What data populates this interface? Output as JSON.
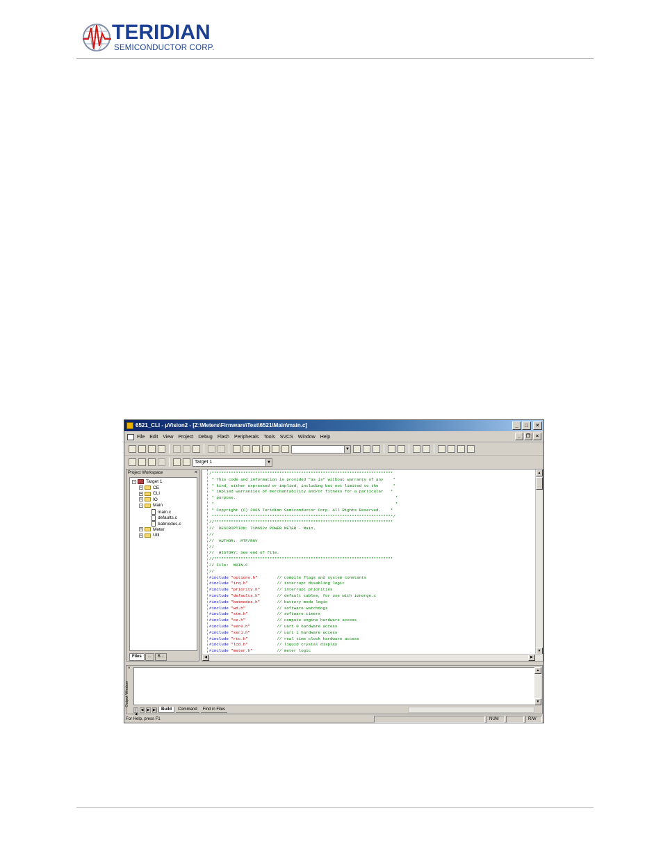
{
  "header": {
    "brand": "TERIDIAN",
    "subtitle": "SEMICONDUCTOR CORP."
  },
  "window": {
    "title": "6521_CLI - µVision2 - [Z:\\Meters\\Firmware\\Test\\6521\\Main\\main.c]",
    "menu": [
      "File",
      "Edit",
      "View",
      "Project",
      "Debug",
      "Flash",
      "Peripherals",
      "Tools",
      "SVCS",
      "Window",
      "Help"
    ],
    "toolbar_combo_value": "",
    "target_combo_value": "Target 1"
  },
  "workspace": {
    "title": "Project Workspace",
    "close_glyph": "×",
    "tree": [
      {
        "label": "Target 1",
        "kind": "target",
        "depth": 0,
        "expander": "-"
      },
      {
        "label": "CE",
        "kind": "folder",
        "depth": 1,
        "expander": "+"
      },
      {
        "label": "CLI",
        "kind": "folder",
        "depth": 1,
        "expander": "+"
      },
      {
        "label": "IO",
        "kind": "folder",
        "depth": 1,
        "expander": "+"
      },
      {
        "label": "Main",
        "kind": "folder",
        "depth": 1,
        "expander": "-"
      },
      {
        "label": "main.c",
        "kind": "file",
        "depth": 2,
        "expander": ""
      },
      {
        "label": "defaults.c",
        "kind": "file",
        "depth": 2,
        "expander": ""
      },
      {
        "label": "batmodes.c",
        "kind": "file",
        "depth": 2,
        "expander": ""
      },
      {
        "label": "Meter",
        "kind": "folder",
        "depth": 1,
        "expander": "+"
      },
      {
        "label": "Util",
        "kind": "folder",
        "depth": 1,
        "expander": "+"
      }
    ],
    "tabs": [
      "Files",
      "...",
      "B..."
    ]
  },
  "editor": {
    "lines": [
      [
        {
          "t": "/***************************************************************************",
          "c": "g"
        }
      ],
      [
        {
          "t": " * This code and information is provided \"as is\" without warranty of any    *",
          "c": "g"
        }
      ],
      [
        {
          "t": " * kind, either expressed or implied, including but not limited to the      *",
          "c": "g"
        }
      ],
      [
        {
          "t": " * implied warranties of merchantability and/or fitness for a particular   *",
          "c": "g"
        }
      ],
      [
        {
          "t": " * purpose.                                                                  *",
          "c": "g"
        }
      ],
      [
        {
          "t": " *                                                                           *",
          "c": "g"
        }
      ],
      [
        {
          "t": " * Copyright (C) 2005 Teridian Semiconductor Corp. All Rights Reserved.    *",
          "c": "g"
        }
      ],
      [
        {
          "t": " ***************************************************************************/",
          "c": "g"
        }
      ],
      [
        {
          "t": "//**************************************************************************",
          "c": "g"
        }
      ],
      [
        {
          "t": "//  DESCRIPTION: 71M652x POWER METER - Main.",
          "c": "g"
        }
      ],
      [
        {
          "t": "//",
          "c": "g"
        }
      ],
      [
        {
          "t": "//  AUTHOR:  MTF/RGV",
          "c": "g"
        }
      ],
      [
        {
          "t": "//",
          "c": "g"
        }
      ],
      [
        {
          "t": "//  HISTORY: See end of file.",
          "c": "g"
        }
      ],
      [
        {
          "t": "//**************************************************************************",
          "c": "g"
        }
      ],
      [
        {
          "t": "// File:  MAIN.C",
          "c": "g"
        }
      ],
      [
        {
          "t": "//",
          "c": "g"
        }
      ],
      [
        {
          "t": "#include ",
          "c": "b"
        },
        {
          "t": "\"options.h\"",
          "c": "r"
        },
        {
          "t": "        // compile flags and system constants",
          "c": "g"
        }
      ],
      [
        {
          "t": "#include ",
          "c": "b"
        },
        {
          "t": "\"irq.h\"",
          "c": "r"
        },
        {
          "t": "            // interrupt disabling logic",
          "c": "g"
        }
      ],
      [
        {
          "t": "#include ",
          "c": "b"
        },
        {
          "t": "\"priority.h\"",
          "c": "r"
        },
        {
          "t": "       // interrupt priorities",
          "c": "g"
        }
      ],
      [
        {
          "t": "#include ",
          "c": "b"
        },
        {
          "t": "\"defaults.h\"",
          "c": "r"
        },
        {
          "t": "       // default tables, for use with ionorge.c",
          "c": "g"
        }
      ],
      [
        {
          "t": "#include ",
          "c": "b"
        },
        {
          "t": "\"batmodes.h\"",
          "c": "r"
        },
        {
          "t": "       // battery mode logic",
          "c": "g"
        }
      ],
      [
        {
          "t": "#include ",
          "c": "b"
        },
        {
          "t": "\"wd.h\"",
          "c": "r"
        },
        {
          "t": "             // software watchdogs",
          "c": "g"
        }
      ],
      [
        {
          "t": "#include ",
          "c": "b"
        },
        {
          "t": "\"stm.h\"",
          "c": "r"
        },
        {
          "t": "            // software timers",
          "c": "g"
        }
      ],
      [
        {
          "t": "#include ",
          "c": "b"
        },
        {
          "t": "\"ce.h\"",
          "c": "r"
        },
        {
          "t": "             // compute engine hardware access",
          "c": "g"
        }
      ],
      [
        {
          "t": "#include ",
          "c": "b"
        },
        {
          "t": "\"ser0.h\"",
          "c": "r"
        },
        {
          "t": "           // uart 0 hardware access",
          "c": "g"
        }
      ],
      [
        {
          "t": "#include ",
          "c": "b"
        },
        {
          "t": "\"ser1.h\"",
          "c": "r"
        },
        {
          "t": "           // uart 1 hardware access",
          "c": "g"
        }
      ],
      [
        {
          "t": "#include ",
          "c": "b"
        },
        {
          "t": "\"rtc.h\"",
          "c": "r"
        },
        {
          "t": "            // real time clock hardware access",
          "c": "g"
        }
      ],
      [
        {
          "t": "#include ",
          "c": "b"
        },
        {
          "t": "\"lcd.h\"",
          "c": "r"
        },
        {
          "t": "            // liquid crystal display",
          "c": "g"
        }
      ],
      [
        {
          "t": "#include ",
          "c": "b"
        },
        {
          "t": "\"meter.h\"",
          "c": "r"
        },
        {
          "t": "          // meter logic",
          "c": "g"
        }
      ]
    ]
  },
  "output": {
    "side_label": "Output Window",
    "close_glyph": "×",
    "tabs": [
      "Build",
      "Command",
      "Find in Files"
    ]
  },
  "status": {
    "help": "For Help, press F1",
    "num": "NUM",
    "rw": "R/W"
  }
}
